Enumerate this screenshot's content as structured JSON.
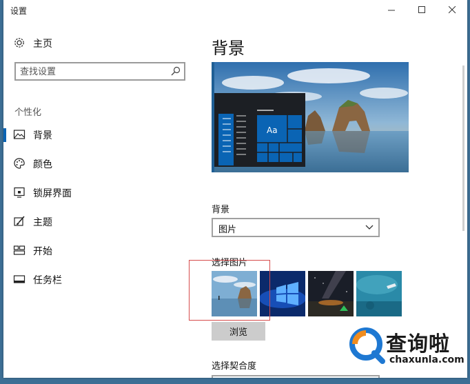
{
  "window": {
    "title": "设置"
  },
  "sidebar": {
    "home_label": "主页",
    "search_placeholder": "查找设置",
    "section_header": "个性化",
    "items": [
      {
        "label": "背景",
        "icon": "picture-icon",
        "selected": true
      },
      {
        "label": "颜色",
        "icon": "palette-icon",
        "selected": false
      },
      {
        "label": "锁屏界面",
        "icon": "lock-screen-icon",
        "selected": false
      },
      {
        "label": "主题",
        "icon": "brush-icon",
        "selected": false
      },
      {
        "label": "开始",
        "icon": "start-tiles-icon",
        "selected": false
      },
      {
        "label": "任务栏",
        "icon": "taskbar-icon",
        "selected": false
      }
    ]
  },
  "main": {
    "title": "背景",
    "preview": {
      "tile_text": "Aa"
    },
    "background_label": "背景",
    "background_value": "图片",
    "choose_picture_label": "选择图片",
    "browse_label": "浏览",
    "fit_label": "选择契合度"
  },
  "watermark": {
    "text": "查询啦",
    "domain": "chaxunla.com"
  },
  "colors": {
    "accent": "#0a64b4",
    "annotation": "#d64a4a",
    "watermark_blue": "#1e78d2",
    "watermark_orange": "#f08c1e"
  }
}
